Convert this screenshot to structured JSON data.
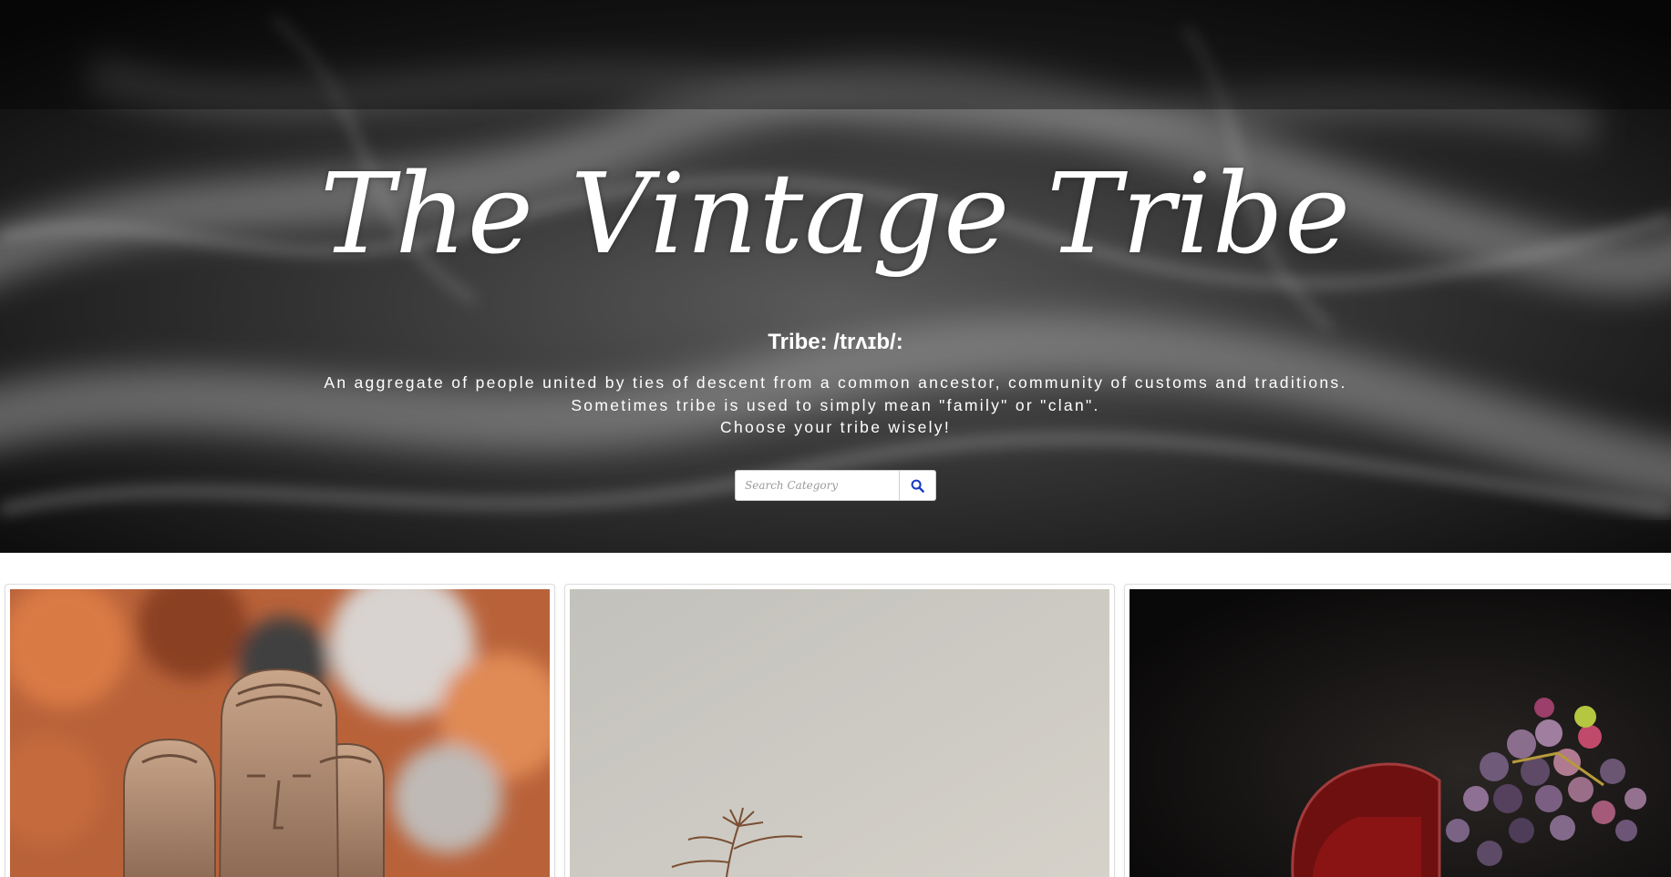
{
  "hero": {
    "title": "The Vintage Tribe",
    "subtitle": "Tribe: /trʌɪb/:",
    "description_lines": [
      "An aggregate of people united by ties of descent from a common ancestor, community of customs and traditions.",
      "Sometimes tribe is used to simply mean \"family\" or \"clan\".",
      "Choose your tribe wisely!"
    ]
  },
  "search": {
    "placeholder": "Search Category",
    "value": "",
    "button_icon": "search-icon"
  },
  "cards": [
    {
      "image": "wooden-carved-heads-photo"
    },
    {
      "image": "dried-plant-photo"
    },
    {
      "image": "red-wine-grapes-photo"
    }
  ],
  "colors": {
    "hero_background": "#0b0b0b",
    "text": "#ffffff",
    "search_icon": "#1a3cc4",
    "card_border": "#dcdcdc"
  }
}
